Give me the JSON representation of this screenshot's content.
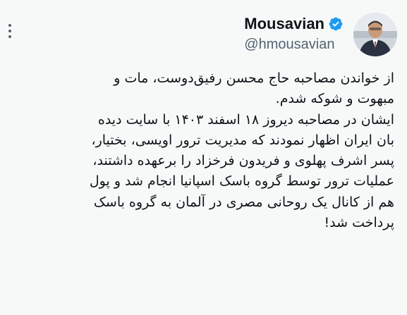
{
  "profile": {
    "display_name": "Mousavian",
    "handle": "@hmousavian",
    "verified_badge_color": "#1d9bf0",
    "avatar_icon": "profile-photo"
  },
  "menu": {
    "icon": "more-vertical-icon"
  },
  "tweet": {
    "text": "از خواندن مصاحبه حاج محسن رفیق‌دوست، مات و\nمبهوت و شوکه شدم.\nایشان در مصاحبه دیروز ۱۸ اسفند ۱۴۰۳ با سایت دیده\nبان ایران اظهار نمودند که مدیریت ترور اویسی، بختیار،\nپسر اشرف پهلوی و فریدون فرخزاد را برعهده داشتند،\nعملیات ترور توسط گروه باسک اسپانیا انجام شد و پول\nهم از کانال یک روحانی مصری در آلمان به گروه باسک\nپرداخت شد!"
  },
  "colors": {
    "background": "#f7f9f9",
    "text_primary": "#0f1419",
    "text_secondary": "#536471"
  }
}
